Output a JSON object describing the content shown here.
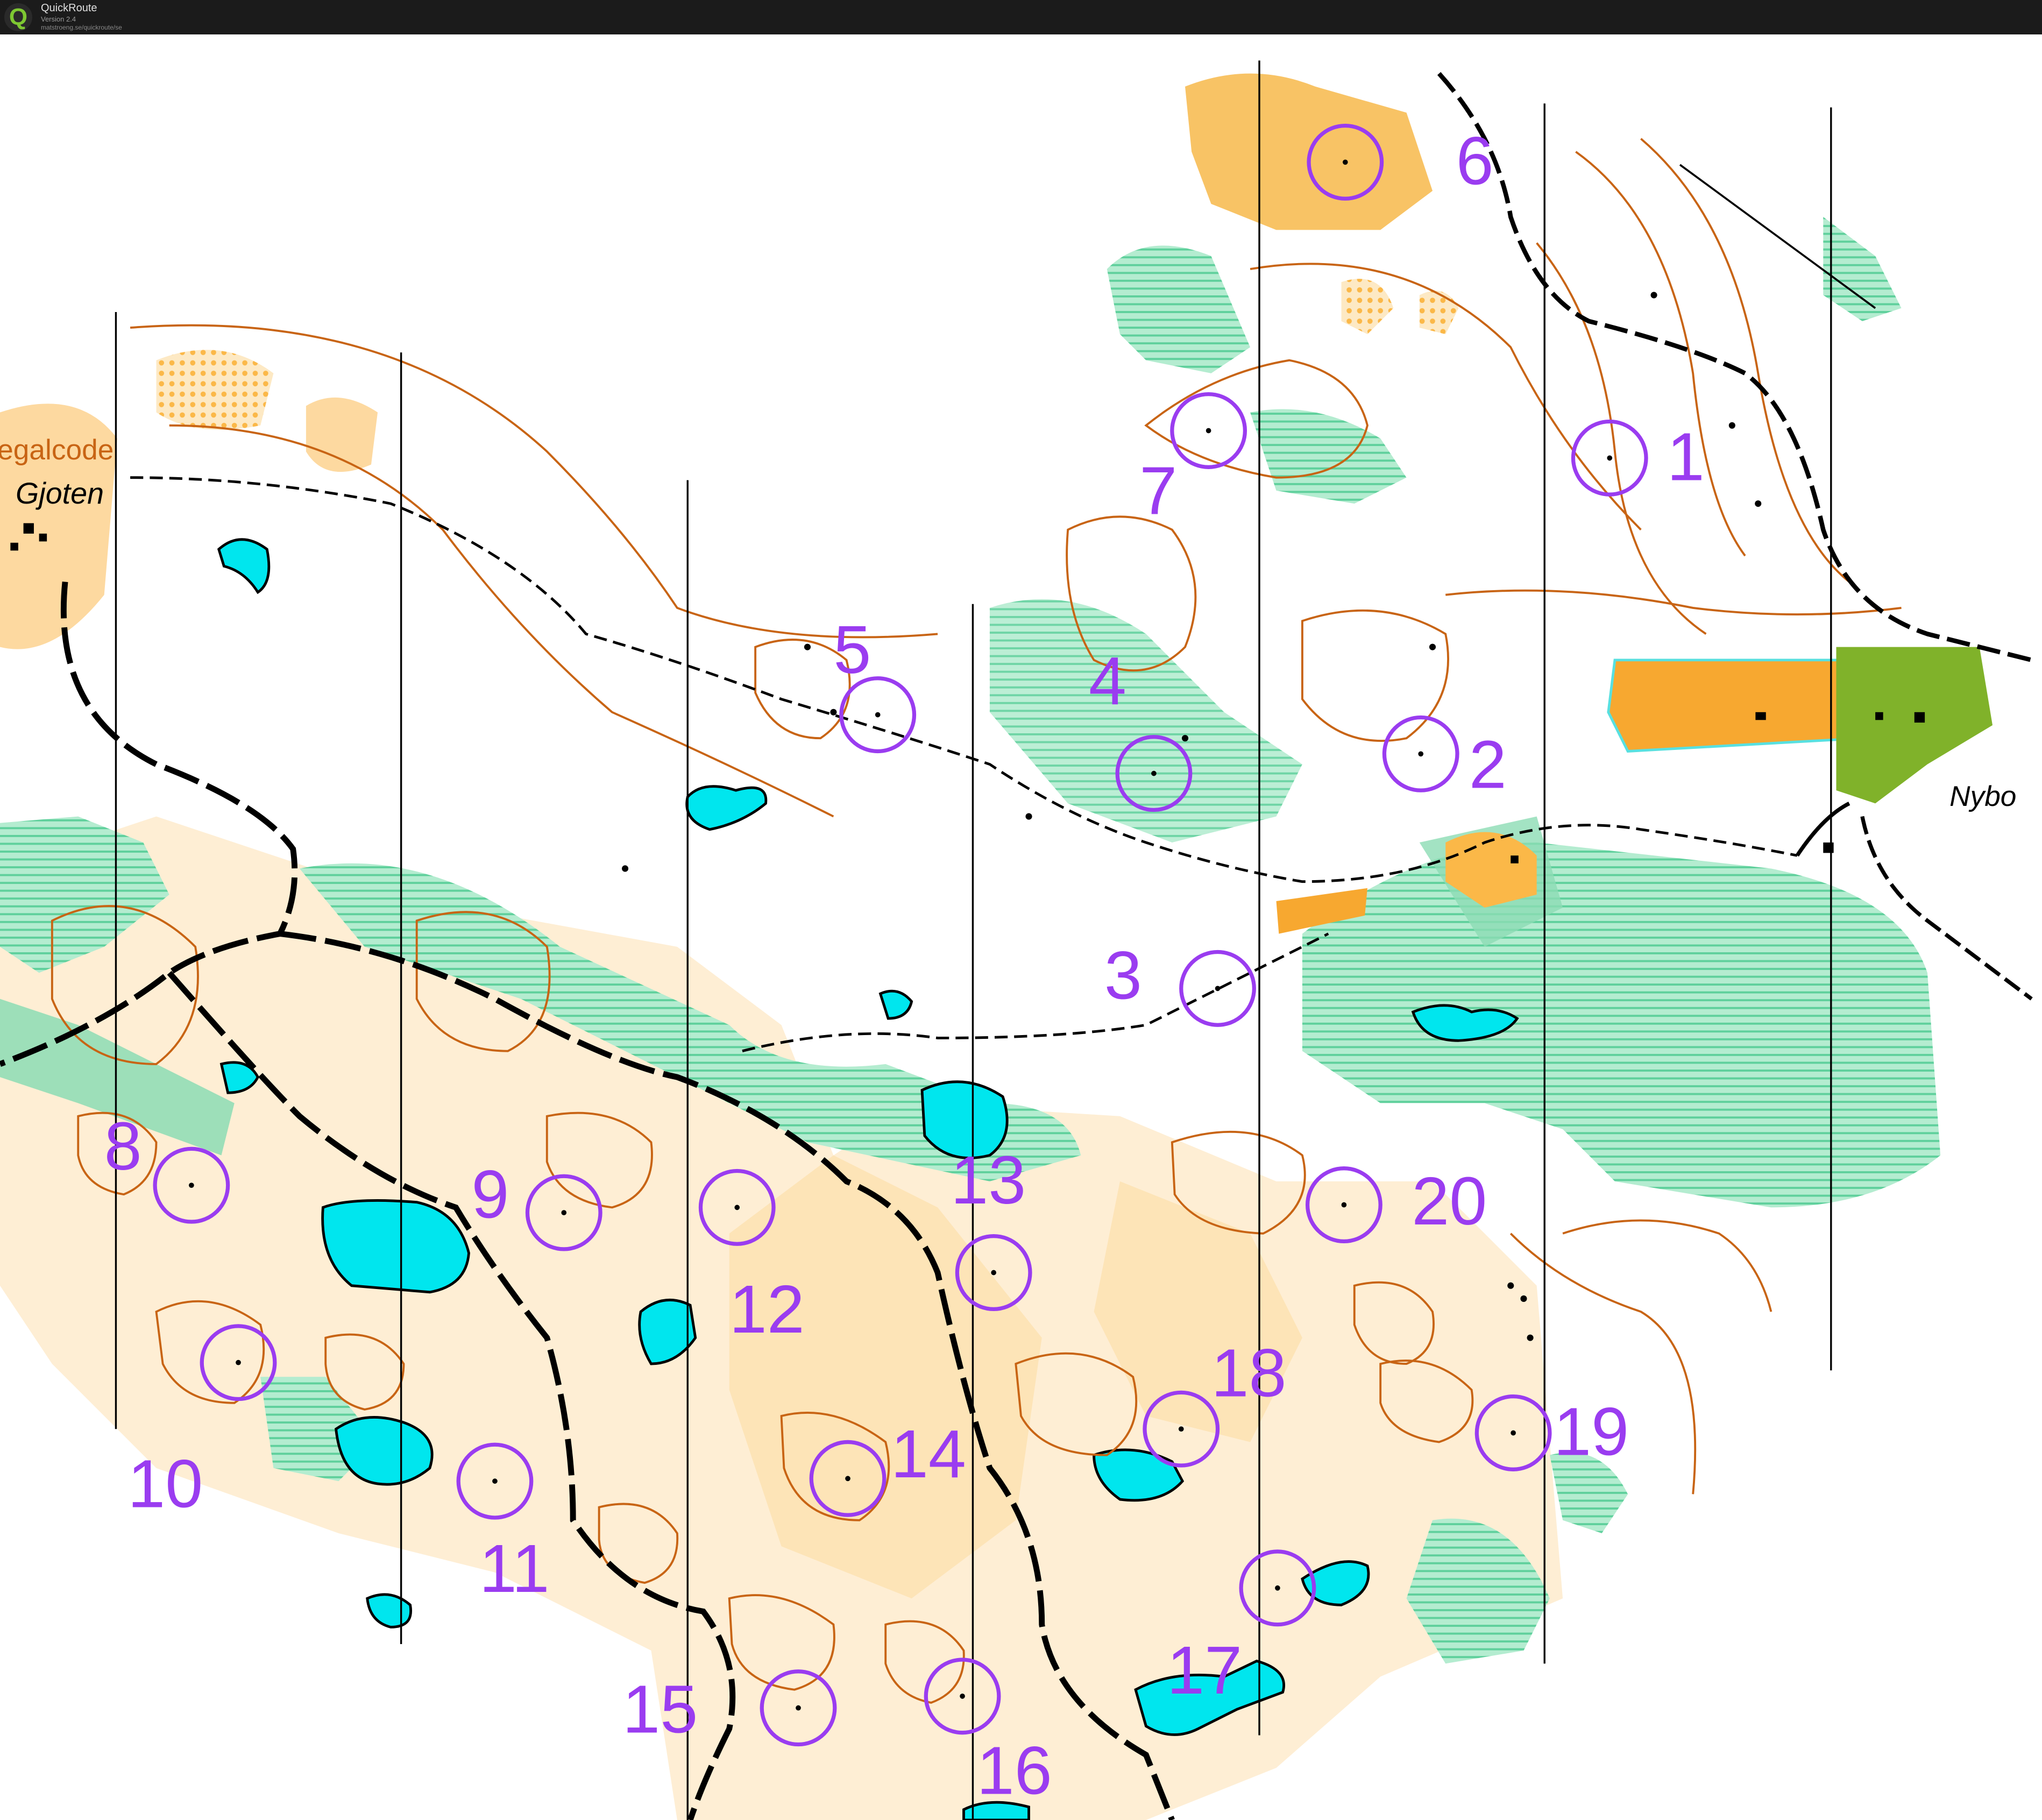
{
  "app": {
    "title": "QuickRoute",
    "version": "Version 2.4",
    "url": "matstroeng.se/quickroute/se",
    "logo_letter": "Q"
  },
  "map": {
    "place_labels": [
      "Gjoten",
      "Nybo"
    ],
    "partial_text": "egalcode",
    "colors": {
      "course": "#9a3cf0",
      "contour": "#c86414",
      "open_land": "#fbb848",
      "rough_open": "#fde2b4",
      "green": "#8cdcb4",
      "water": "#00e6ee",
      "settlement": "#6aa51e",
      "road": "#000000"
    }
  },
  "controls": [
    {
      "number": "1"
    },
    {
      "number": "2"
    },
    {
      "number": "3"
    },
    {
      "number": "4"
    },
    {
      "number": "5"
    },
    {
      "number": "6"
    },
    {
      "number": "7"
    },
    {
      "number": "8"
    },
    {
      "number": "9"
    },
    {
      "number": "10"
    },
    {
      "number": "11"
    },
    {
      "number": "12"
    },
    {
      "number": "13"
    },
    {
      "number": "14"
    },
    {
      "number": "15"
    },
    {
      "number": "16"
    },
    {
      "number": "17"
    },
    {
      "number": "18"
    },
    {
      "number": "19"
    },
    {
      "number": "20"
    }
  ]
}
